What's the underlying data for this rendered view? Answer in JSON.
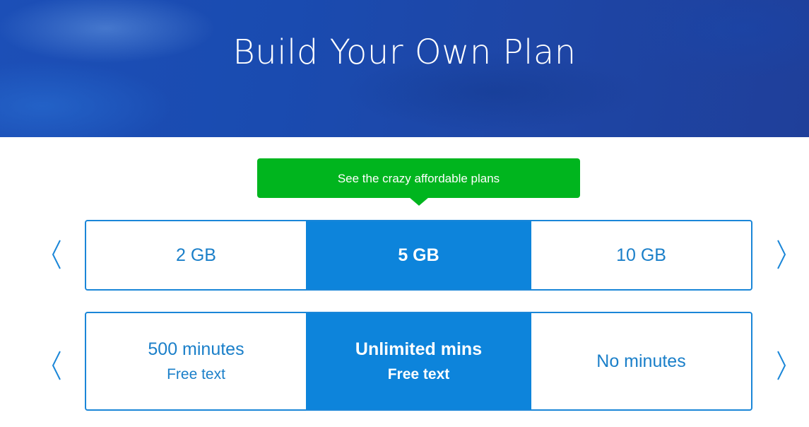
{
  "hero": {
    "title": "Build Your Own Plan"
  },
  "cta": {
    "label": "See the crazy affordable plans",
    "color": "#00b51e"
  },
  "data_selector": {
    "options": [
      {
        "label": "2 GB",
        "selected": false
      },
      {
        "label": "5 GB",
        "selected": true
      },
      {
        "label": "10 GB",
        "selected": false
      }
    ]
  },
  "minutes_selector": {
    "options": [
      {
        "label": "500 minutes",
        "sub": "Free text",
        "selected": false
      },
      {
        "label": "Unlimited mins",
        "sub": "Free text",
        "selected": true
      },
      {
        "label": "No minutes",
        "sub": "",
        "selected": false
      }
    ]
  },
  "icons": {
    "prev": "chevron-left-icon",
    "next": "chevron-right-icon"
  },
  "colors": {
    "accent": "#1a86d8",
    "selected_bg": "#0d84db",
    "hero_bg": "#1c4fb7"
  }
}
